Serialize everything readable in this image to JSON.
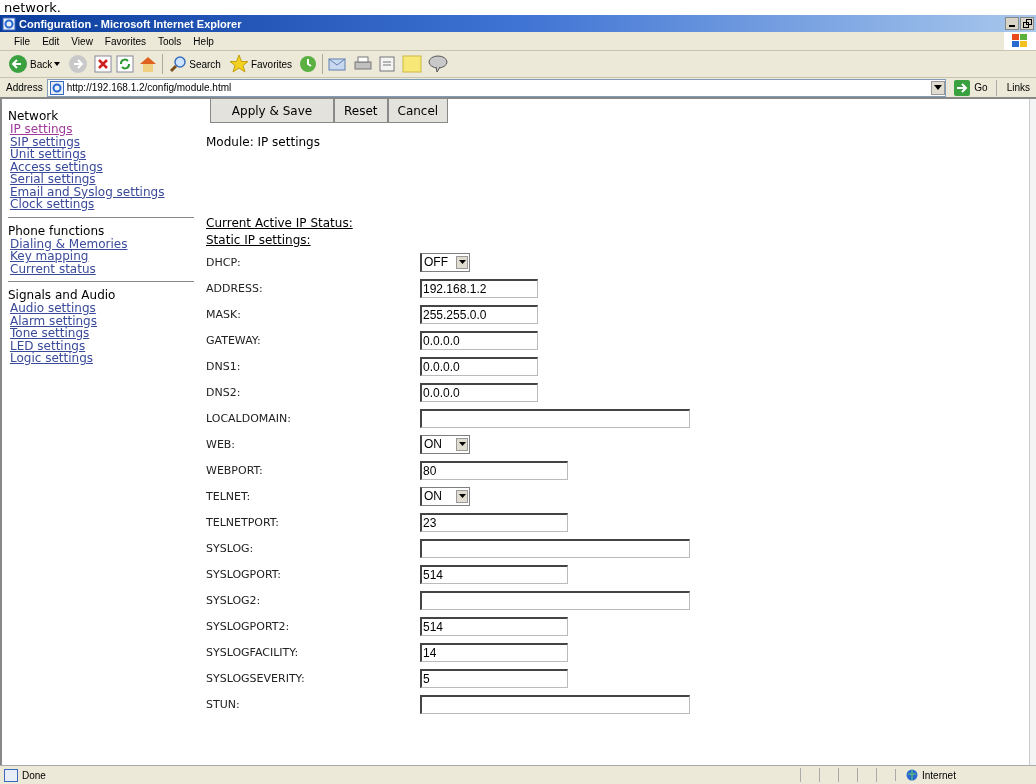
{
  "caption": "network.",
  "window": {
    "title": "Configuration - Microsoft Internet Explorer"
  },
  "menu": [
    "File",
    "Edit",
    "View",
    "Favorites",
    "Tools",
    "Help"
  ],
  "toolbar": {
    "back": "Back",
    "search": "Search",
    "favorites": "Favorites"
  },
  "address_bar": {
    "label": "Address",
    "url": "http://192.168.1.2/config/module.html",
    "go": "Go",
    "links": "Links"
  },
  "sidebar": [
    {
      "heading": "Network",
      "items": [
        {
          "label": "IP settings",
          "selected": true
        },
        {
          "label": "SIP settings",
          "selected": false
        },
        {
          "label": "Unit settings",
          "selected": false
        },
        {
          "label": "Access settings",
          "selected": false
        },
        {
          "label": "Serial settings",
          "selected": false
        },
        {
          "label": "Email and Syslog settings",
          "selected": false
        },
        {
          "label": "Clock settings",
          "selected": false
        }
      ]
    },
    {
      "heading": "Phone functions",
      "items": [
        {
          "label": "Dialing & Memories",
          "selected": false
        },
        {
          "label": "Key mapping",
          "selected": false
        },
        {
          "label": "Current status",
          "selected": false
        }
      ]
    },
    {
      "heading": "Signals and Audio",
      "items": [
        {
          "label": "Audio settings",
          "selected": false
        },
        {
          "label": "Alarm settings",
          "selected": false
        },
        {
          "label": "Tone settings",
          "selected": false
        },
        {
          "label": "LED settings",
          "selected": false
        },
        {
          "label": "Logic settings",
          "selected": false
        }
      ]
    }
  ],
  "buttons": [
    "Apply & Save",
    "Reset",
    "Cancel"
  ],
  "module": "Module: IP settings",
  "section_links": [
    "Current Active IP Status:",
    "Static IP settings:"
  ],
  "fields": [
    {
      "label": "DHCP:",
      "kind": "select",
      "value": "OFF"
    },
    {
      "label": "ADDRESS:",
      "kind": "text",
      "value": "192.168.1.2"
    },
    {
      "label": "MASK:",
      "kind": "text",
      "value": "255.255.0.0"
    },
    {
      "label": "GATEWAY:",
      "kind": "text",
      "value": "0.0.0.0"
    },
    {
      "label": "DNS1:",
      "kind": "text",
      "value": "0.0.0.0"
    },
    {
      "label": "DNS2:",
      "kind": "text",
      "value": "0.0.0.0"
    },
    {
      "label": "LOCALDOMAIN:",
      "kind": "wide"
    },
    {
      "label": "WEB:",
      "kind": "select",
      "value": "ON"
    },
    {
      "label": "WEBPORT:",
      "kind": "port",
      "value": "80"
    },
    {
      "label": "TELNET:",
      "kind": "select",
      "value": "ON"
    },
    {
      "label": "TELNETPORT:",
      "kind": "port",
      "value": "23"
    },
    {
      "label": "SYSLOG:",
      "kind": "wide"
    },
    {
      "label": "SYSLOGPORT:",
      "kind": "port",
      "value": "514"
    },
    {
      "label": "SYSLOG2:",
      "kind": "wide"
    },
    {
      "label": "SYSLOGPORT2:",
      "kind": "port",
      "value": "514"
    },
    {
      "label": "SYSLOGFACILITY:",
      "kind": "port",
      "value": "14"
    },
    {
      "label": "SYSLOGSEVERITY:",
      "kind": "port",
      "value": "5"
    },
    {
      "label": "STUN:",
      "kind": "wide"
    }
  ],
  "status_bar": {
    "text": "Done",
    "zone": "Internet"
  }
}
